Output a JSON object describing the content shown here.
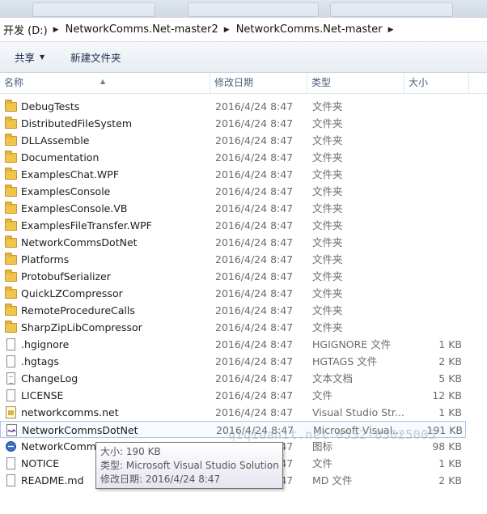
{
  "breadcrumb": [
    "开发 (D:)",
    "NetworkComms.Net-master2",
    "NetworkComms.Net-master"
  ],
  "toolbar": {
    "share_label": "共享",
    "new_folder_label": "新建文件夹"
  },
  "columns": {
    "name": "名称",
    "date": "修改日期",
    "type": "类型",
    "size": "大小"
  },
  "files": [
    {
      "name": "DebugTests",
      "date": "2016/4/24 8:47",
      "type": "文件夹",
      "size": "",
      "icon": "folder-icon"
    },
    {
      "name": "DistributedFileSystem",
      "date": "2016/4/24 8:47",
      "type": "文件夹",
      "size": "",
      "icon": "folder-icon"
    },
    {
      "name": "DLLAssemble",
      "date": "2016/4/24 8:47",
      "type": "文件夹",
      "size": "",
      "icon": "folder-icon"
    },
    {
      "name": "Documentation",
      "date": "2016/4/24 8:47",
      "type": "文件夹",
      "size": "",
      "icon": "folder-icon"
    },
    {
      "name": "ExamplesChat.WPF",
      "date": "2016/4/24 8:47",
      "type": "文件夹",
      "size": "",
      "icon": "folder-icon"
    },
    {
      "name": "ExamplesConsole",
      "date": "2016/4/24 8:47",
      "type": "文件夹",
      "size": "",
      "icon": "folder-icon"
    },
    {
      "name": "ExamplesConsole.VB",
      "date": "2016/4/24 8:47",
      "type": "文件夹",
      "size": "",
      "icon": "folder-icon"
    },
    {
      "name": "ExamplesFileTransfer.WPF",
      "date": "2016/4/24 8:47",
      "type": "文件夹",
      "size": "",
      "icon": "folder-icon"
    },
    {
      "name": "NetworkCommsDotNet",
      "date": "2016/4/24 8:47",
      "type": "文件夹",
      "size": "",
      "icon": "folder-icon"
    },
    {
      "name": "Platforms",
      "date": "2016/4/24 8:47",
      "type": "文件夹",
      "size": "",
      "icon": "folder-icon"
    },
    {
      "name": "ProtobufSerializer",
      "date": "2016/4/24 8:47",
      "type": "文件夹",
      "size": "",
      "icon": "folder-icon"
    },
    {
      "name": "QuickLZCompressor",
      "date": "2016/4/24 8:47",
      "type": "文件夹",
      "size": "",
      "icon": "folder-icon"
    },
    {
      "name": "RemoteProcedureCalls",
      "date": "2016/4/24 8:47",
      "type": "文件夹",
      "size": "",
      "icon": "folder-icon"
    },
    {
      "name": "SharpZipLibCompressor",
      "date": "2016/4/24 8:47",
      "type": "文件夹",
      "size": "",
      "icon": "folder-icon"
    },
    {
      "name": ".hgignore",
      "date": "2016/4/24 8:47",
      "type": "HGIGNORE 文件",
      "size": "1 KB",
      "icon": "file-icon"
    },
    {
      "name": ".hgtags",
      "date": "2016/4/24 8:47",
      "type": "HGTAGS 文件",
      "size": "2 KB",
      "icon": "file-icon"
    },
    {
      "name": "ChangeLog",
      "date": "2016/4/24 8:47",
      "type": "文本文档",
      "size": "5 KB",
      "icon": "text-file-icon"
    },
    {
      "name": "LICENSE",
      "date": "2016/4/24 8:47",
      "type": "文件",
      "size": "12 KB",
      "icon": "file-icon"
    },
    {
      "name": "networkcomms.net",
      "date": "2016/4/24 8:47",
      "type": "Visual Studio Str...",
      "size": "1 KB",
      "icon": "vs-settings-icon"
    },
    {
      "name": "NetworkCommsDotNet",
      "date": "2016/4/24 8:47",
      "type": "Microsoft Visual...",
      "size": "191 KB",
      "icon": "vs-solution-icon"
    },
    {
      "name": "NetworkCommsLogo",
      "date": "2016/4/24 8:47",
      "type": "图标",
      "size": "98 KB",
      "icon": "logo-ico-icon"
    },
    {
      "name": "NOTICE",
      "date": "2016/4/24 8:47",
      "type": "文件",
      "size": "1 KB",
      "icon": "file-icon"
    },
    {
      "name": "README.md",
      "date": "2016/4/24 8:47",
      "type": "MD 文件",
      "size": "2 KB",
      "icon": "file-icon"
    }
  ],
  "tooltip": {
    "size_line": "大小: 190 KB",
    "type_line": "类型: Microsoft Visual Studio Solution",
    "date_line": "修改日期: 2016/4/24 8:47"
  },
  "watermark": "qiqiuanit.net  0532-85025005"
}
